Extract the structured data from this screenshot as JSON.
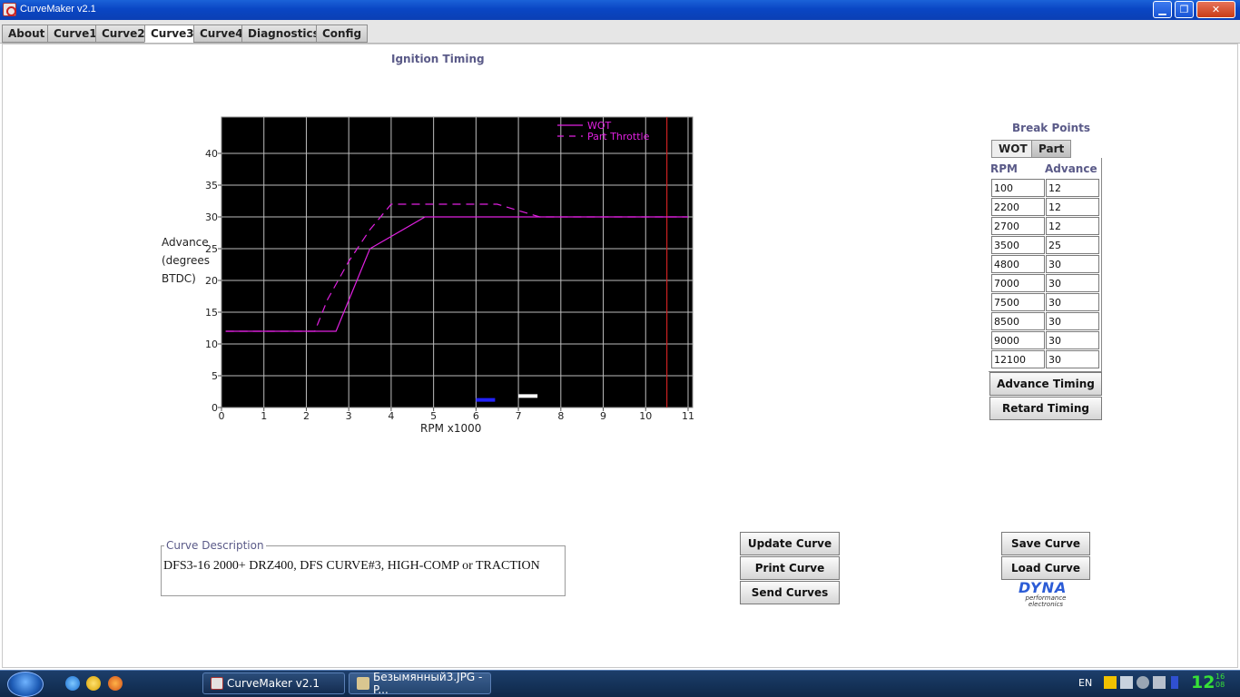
{
  "window": {
    "title": "CurveMaker v2.1"
  },
  "tabs": [
    {
      "label": "About"
    },
    {
      "label": "Curve1"
    },
    {
      "label": "Curve2"
    },
    {
      "label": "Curve3",
      "active": true
    },
    {
      "label": "Curve4"
    },
    {
      "label": "Diagnostics"
    },
    {
      "label": "Config"
    }
  ],
  "chart_data": {
    "type": "line",
    "title": "Ignition Timing",
    "xlabel": "RPM x1000",
    "ylabel": "Advance (degrees BTDC)",
    "ylabel_lines": [
      "Advance",
      "(degrees",
      "BTDC)"
    ],
    "xlim": [
      0,
      11
    ],
    "ylim": [
      0,
      45
    ],
    "x_ticks": [
      0,
      1,
      2,
      3,
      4,
      5,
      6,
      7,
      8,
      9,
      10,
      11
    ],
    "y_ticks": [
      0,
      5,
      10,
      15,
      20,
      25,
      30,
      35,
      40
    ],
    "grid": true,
    "legend_position": "top-right",
    "background": "#000000",
    "line_color": "#e020e0",
    "marker_x": 10.5,
    "marker_color": "#cc2222",
    "series": [
      {
        "name": "WOT",
        "style": "solid",
        "x": [
          0.1,
          2.2,
          2.7,
          3.5,
          4.8,
          7.0,
          7.5,
          8.5,
          9.0,
          11.0
        ],
        "y": [
          12,
          12,
          12,
          25,
          30,
          30,
          30,
          30,
          30,
          30
        ]
      },
      {
        "name": "Part Throttle",
        "style": "dashed",
        "x": [
          0.1,
          2.2,
          2.5,
          3.0,
          3.5,
          4.0,
          5.0,
          6.0,
          6.5,
          7.0,
          7.5,
          11.0
        ],
        "y": [
          12,
          12,
          17,
          23,
          28,
          32,
          32,
          32,
          32,
          31,
          30,
          30
        ]
      }
    ],
    "indicators": [
      {
        "color": "#2222ff",
        "x": [
          6.0,
          6.45
        ],
        "y": 1.2
      },
      {
        "color": "#ffffff",
        "x": [
          7.0,
          7.45
        ],
        "y": 1.8
      }
    ]
  },
  "breakpoints": {
    "title": "Break Points",
    "tabs": [
      {
        "label": "WOT",
        "active": true
      },
      {
        "label": "Part"
      }
    ],
    "col_rpm": "RPM",
    "col_advance": "Advance",
    "rows": [
      {
        "rpm": "100",
        "advance": "12"
      },
      {
        "rpm": "2200",
        "advance": "12"
      },
      {
        "rpm": "2700",
        "advance": "12"
      },
      {
        "rpm": "3500",
        "advance": "25"
      },
      {
        "rpm": "4800",
        "advance": "30"
      },
      {
        "rpm": "7000",
        "advance": "30"
      },
      {
        "rpm": "7500",
        "advance": "30"
      },
      {
        "rpm": "8500",
        "advance": "30"
      },
      {
        "rpm": "9000",
        "advance": "30"
      },
      {
        "rpm": "12100",
        "advance": "30"
      }
    ],
    "advance_button": "Advance Timing",
    "retard_button": "Retard Timing"
  },
  "description": {
    "legend": "Curve Description",
    "text": "DFS3-16 2000+ DRZ400, DFS CURVE#3, HIGH-COMP or TRACTION"
  },
  "buttons": {
    "update": "Update Curve",
    "print": "Print Curve",
    "send": "Send Curves",
    "save": "Save Curve",
    "load": "Load Curve"
  },
  "logo": {
    "name": "DYNA",
    "subtitle": "performance electronics"
  },
  "taskbar": {
    "tasks": [
      {
        "label": "CurveMaker v2.1",
        "active": true
      },
      {
        "label": "Безымянный3.JPG - P..."
      }
    ],
    "lang": "EN",
    "clock_hour": "12",
    "clock_min1": "16",
    "clock_min2": "08"
  }
}
